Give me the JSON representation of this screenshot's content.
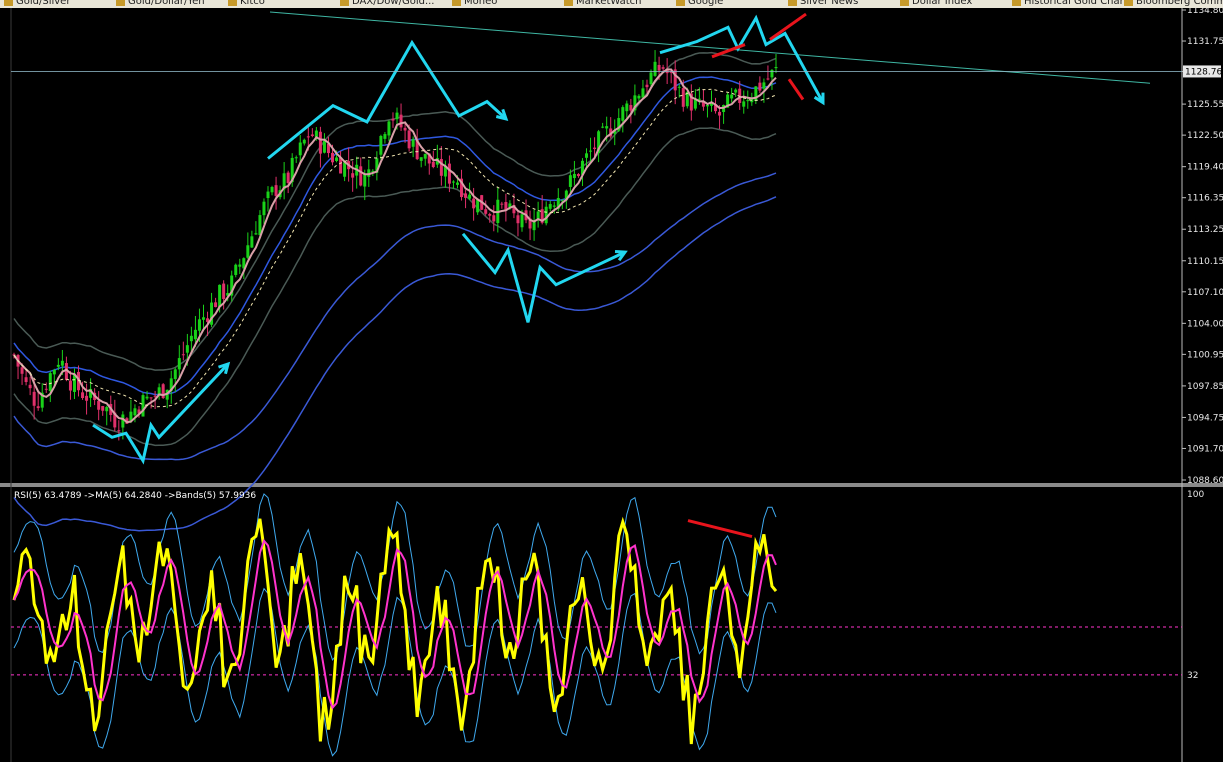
{
  "browser_bookmarks": [
    {
      "label": "Gold/Silver"
    },
    {
      "label": "Gold/Dollar/Yen"
    },
    {
      "label": "Kitco"
    },
    {
      "label": "DAX/Dow/Gold..."
    },
    {
      "label": "Moneo"
    },
    {
      "label": "MarketWatch"
    },
    {
      "label": "Google"
    },
    {
      "label": "Silver News"
    },
    {
      "label": "Dollar Index"
    },
    {
      "label": "Historical Gold Charts"
    },
    {
      "label": "Bloomberg Commodities"
    }
  ],
  "colors": {
    "background": "#000000",
    "candle_up": "#19d219",
    "candle_down": "#e0306a",
    "ma": "#d9a0a8",
    "dashed_ma": "#f2e6b0",
    "bands_outer": "#3a59d6",
    "bands_inner": "#4a5a55",
    "trend_line": "#3fb7a4",
    "annotation": "#22d7f0",
    "annotation_red": "#e8141c",
    "rsi": "#ffff00",
    "rsi_ma": "#ff33cc",
    "rsi_bands": "#3fa9ee",
    "level_line": "#ff33cc"
  },
  "price_axis": {
    "ticks": [
      "1134.80",
      "1131.75",
      "1128.76",
      "1125.55",
      "1122.50",
      "1119.40",
      "1116.35",
      "1113.25",
      "1110.15",
      "1107.10",
      "1104.00",
      "1100.95",
      "1097.85",
      "1094.75",
      "1091.70",
      "1088.60"
    ],
    "current_price": "1128.76"
  },
  "indicator": {
    "label": "RSI(5) 63.4789  ->MA(5) 64.2840  ->Bands(5) 57.9936",
    "axis_ticks": [
      "100",
      "32"
    ]
  },
  "chart_data": [
    {
      "type": "candlestick",
      "title": "",
      "ylim": [
        1088.6,
        1134.8
      ],
      "y_ticks": [
        1134.8,
        1131.75,
        1128.76,
        1125.55,
        1122.5,
        1119.4,
        1116.35,
        1113.25,
        1110.15,
        1107.1,
        1104.0,
        1100.95,
        1097.85,
        1094.75,
        1091.7,
        1088.6
      ],
      "current_price": 1128.76,
      "close_path": [
        1100.9,
        1098.0,
        1096.2,
        1098.6,
        1100.7,
        1098.3,
        1097.2,
        1096.4,
        1095.8,
        1094.4,
        1094.9,
        1096.1,
        1096.7,
        1097.4,
        1099.0,
        1101.3,
        1103.6,
        1105.1,
        1106.7,
        1107.6,
        1110.2,
        1113.0,
        1115.5,
        1117.3,
        1118.0,
        1120.7,
        1122.8,
        1121.6,
        1120.4,
        1119.6,
        1118.9,
        1118.3,
        1121.5,
        1124.8,
        1123.4,
        1121.6,
        1120.3,
        1119.4,
        1118.6,
        1118.1,
        1116.4,
        1115.7,
        1115.0,
        1115.3,
        1114.4,
        1113.4,
        1114.1,
        1115.9,
        1116.8,
        1117.9,
        1119.7,
        1121.3,
        1122.6,
        1124.0,
        1125.4,
        1126.9,
        1128.3,
        1129.3,
        1127.6,
        1126.1,
        1125.4,
        1125.0,
        1124.4,
        1125.8,
        1126.2,
        1126.8,
        1127.8,
        1128.8
      ],
      "annotation_arrows": "Hand-drawn cyan zig-zag arrows mark swing legs; red arrows mark divergence at recent highs"
    },
    {
      "type": "line",
      "title": "",
      "ylim": [
        0,
        100
      ],
      "y_ticks": [
        100,
        32
      ],
      "level_lines": [
        50,
        32
      ],
      "rsi_last": 63.4789,
      "ma_last": 64.284,
      "bands_last": 57.9936
    }
  ]
}
